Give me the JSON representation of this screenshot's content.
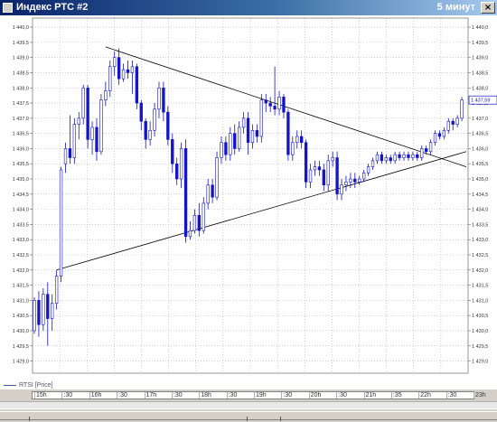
{
  "window": {
    "title": "Индекс РТС #2",
    "right_text": "5 минут",
    "close_glyph": "×"
  },
  "legend": "RTSI [Price]",
  "last_price": "1 437,59",
  "time_labels": [
    "15h",
    ":30",
    "16h",
    ":30",
    "17h",
    ":30",
    "18h",
    ":30",
    "19h",
    ":30",
    "20h",
    ":30",
    "21h",
    ":35",
    "22h",
    ":30",
    "23h"
  ],
  "chart_data": {
    "type": "candlestick",
    "title": "",
    "xlabel": "",
    "ylabel": "",
    "ylim": [
      1428.6,
      1440.3
    ],
    "y_ticks": [
      "1 440,0",
      "1 439,5",
      "1 439,0",
      "1 438,5",
      "1 438,0",
      "1 437,5",
      "1 437,0",
      "1 436,5",
      "1 436,0",
      "1 435,5",
      "1 435,0",
      "1 434,5",
      "1 434,0",
      "1 433,5",
      "1 433,0",
      "1 432,5",
      "1 432,0",
      "1 431,5",
      "1 431,0",
      "1 430,5",
      "1 430,0",
      "1 429,5",
      "1 429,0"
    ],
    "x_range": [
      0,
      97
    ],
    "candles": [
      {
        "x": 0,
        "o": 1430.0,
        "c": 1431.0,
        "h": 1431.1,
        "l": 1429.9
      },
      {
        "x": 1,
        "o": 1431.0,
        "c": 1430.2,
        "h": 1431.3,
        "l": 1429.8
      },
      {
        "x": 2,
        "o": 1430.2,
        "c": 1431.2,
        "h": 1431.4,
        "l": 1430.0
      },
      {
        "x": 3,
        "o": 1431.2,
        "c": 1430.4,
        "h": 1431.6,
        "l": 1429.5
      },
      {
        "x": 4,
        "o": 1430.4,
        "c": 1430.9,
        "h": 1431.2,
        "l": 1430.0
      },
      {
        "x": 5,
        "o": 1430.9,
        "c": 1431.8,
        "h": 1432.0,
        "l": 1430.7
      },
      {
        "x": 6,
        "o": 1431.8,
        "c": 1435.3,
        "h": 1435.4,
        "l": 1431.6
      },
      {
        "x": 7,
        "o": 1435.5,
        "c": 1436.0,
        "h": 1436.2,
        "l": 1435.2
      },
      {
        "x": 8,
        "o": 1436.0,
        "c": 1435.7,
        "h": 1437.1,
        "l": 1435.5
      },
      {
        "x": 9,
        "o": 1435.7,
        "c": 1436.8,
        "h": 1437.0,
        "l": 1435.5
      },
      {
        "x": 10,
        "o": 1436.8,
        "c": 1437.0,
        "h": 1437.2,
        "l": 1436.3
      },
      {
        "x": 11,
        "o": 1437.0,
        "c": 1438.0,
        "h": 1438.1,
        "l": 1436.8
      },
      {
        "x": 12,
        "o": 1438.0,
        "c": 1436.3,
        "h": 1438.1,
        "l": 1436.0
      },
      {
        "x": 13,
        "o": 1436.3,
        "c": 1436.7,
        "h": 1436.9,
        "l": 1435.8
      },
      {
        "x": 14,
        "o": 1436.7,
        "c": 1435.9,
        "h": 1437.0,
        "l": 1435.6
      },
      {
        "x": 15,
        "o": 1435.9,
        "c": 1437.6,
        "h": 1437.8,
        "l": 1435.8
      },
      {
        "x": 16,
        "o": 1437.6,
        "c": 1437.9,
        "h": 1438.2,
        "l": 1437.4
      },
      {
        "x": 17,
        "o": 1437.9,
        "c": 1438.7,
        "h": 1438.9,
        "l": 1437.7
      },
      {
        "x": 18,
        "o": 1438.7,
        "c": 1439.0,
        "h": 1439.2,
        "l": 1438.4
      },
      {
        "x": 19,
        "o": 1439.0,
        "c": 1438.3,
        "h": 1439.3,
        "l": 1438.1
      },
      {
        "x": 20,
        "o": 1438.3,
        "c": 1438.6,
        "h": 1438.8,
        "l": 1438.2
      },
      {
        "x": 21,
        "o": 1438.6,
        "c": 1438.5,
        "h": 1438.9,
        "l": 1438.3
      },
      {
        "x": 22,
        "o": 1438.5,
        "c": 1438.7,
        "h": 1438.9,
        "l": 1437.8
      },
      {
        "x": 23,
        "o": 1438.7,
        "c": 1437.5,
        "h": 1438.8,
        "l": 1437.3
      },
      {
        "x": 24,
        "o": 1437.5,
        "c": 1436.9,
        "h": 1437.6,
        "l": 1436.6
      },
      {
        "x": 25,
        "o": 1436.9,
        "c": 1436.3,
        "h": 1437.0,
        "l": 1436.0
      },
      {
        "x": 26,
        "o": 1436.3,
        "c": 1436.6,
        "h": 1436.9,
        "l": 1436.1
      },
      {
        "x": 27,
        "o": 1436.6,
        "c": 1437.3,
        "h": 1437.5,
        "l": 1436.4
      },
      {
        "x": 28,
        "o": 1437.3,
        "c": 1438.0,
        "h": 1438.2,
        "l": 1437.0
      },
      {
        "x": 29,
        "o": 1438.0,
        "c": 1437.2,
        "h": 1438.2,
        "l": 1436.9
      },
      {
        "x": 30,
        "o": 1437.2,
        "c": 1436.3,
        "h": 1437.4,
        "l": 1436.1
      },
      {
        "x": 31,
        "o": 1436.3,
        "c": 1435.5,
        "h": 1436.5,
        "l": 1435.2
      },
      {
        "x": 32,
        "o": 1435.5,
        "c": 1435.0,
        "h": 1435.7,
        "l": 1434.8
      },
      {
        "x": 33,
        "o": 1435.0,
        "c": 1436.0,
        "h": 1436.2,
        "l": 1434.7
      },
      {
        "x": 34,
        "o": 1436.0,
        "c": 1433.1,
        "h": 1436.3,
        "l": 1432.9
      },
      {
        "x": 35,
        "o": 1433.1,
        "c": 1433.3,
        "h": 1433.6,
        "l": 1433.0
      },
      {
        "x": 36,
        "o": 1433.3,
        "c": 1433.8,
        "h": 1434.0,
        "l": 1433.2
      },
      {
        "x": 37,
        "o": 1433.8,
        "c": 1433.3,
        "h": 1434.2,
        "l": 1433.1
      },
      {
        "x": 38,
        "o": 1433.3,
        "c": 1434.2,
        "h": 1434.4,
        "l": 1433.2
      },
      {
        "x": 39,
        "o": 1434.2,
        "c": 1434.8,
        "h": 1435.0,
        "l": 1434.0
      },
      {
        "x": 40,
        "o": 1434.8,
        "c": 1434.4,
        "h": 1435.0,
        "l": 1434.2
      },
      {
        "x": 41,
        "o": 1434.4,
        "c": 1435.7,
        "h": 1435.9,
        "l": 1434.3
      },
      {
        "x": 42,
        "o": 1435.7,
        "c": 1436.2,
        "h": 1436.4,
        "l": 1435.5
      },
      {
        "x": 43,
        "o": 1436.2,
        "c": 1435.8,
        "h": 1436.4,
        "l": 1435.6
      },
      {
        "x": 44,
        "o": 1435.8,
        "c": 1436.5,
        "h": 1436.7,
        "l": 1435.6
      },
      {
        "x": 45,
        "o": 1436.5,
        "c": 1436.0,
        "h": 1436.8,
        "l": 1435.8
      },
      {
        "x": 46,
        "o": 1436.0,
        "c": 1436.7,
        "h": 1436.9,
        "l": 1435.9
      },
      {
        "x": 47,
        "o": 1436.7,
        "c": 1437.0,
        "h": 1437.2,
        "l": 1436.5
      },
      {
        "x": 48,
        "o": 1437.0,
        "c": 1436.2,
        "h": 1437.2,
        "l": 1435.8
      },
      {
        "x": 49,
        "o": 1436.2,
        "c": 1436.6,
        "h": 1436.8,
        "l": 1436.0
      },
      {
        "x": 50,
        "o": 1436.6,
        "c": 1436.4,
        "h": 1436.8,
        "l": 1436.2
      },
      {
        "x": 51,
        "o": 1436.4,
        "c": 1437.6,
        "h": 1437.8,
        "l": 1436.2
      },
      {
        "x": 52,
        "o": 1437.6,
        "c": 1437.5,
        "h": 1437.8,
        "l": 1437.2
      },
      {
        "x": 53,
        "o": 1437.5,
        "c": 1437.4,
        "h": 1437.7,
        "l": 1437.2
      },
      {
        "x": 54,
        "o": 1437.4,
        "c": 1437.3,
        "h": 1438.7,
        "l": 1437.1
      },
      {
        "x": 55,
        "o": 1437.3,
        "c": 1437.7,
        "h": 1437.9,
        "l": 1437.1
      },
      {
        "x": 56,
        "o": 1437.7,
        "c": 1437.2,
        "h": 1437.8,
        "l": 1437.0
      },
      {
        "x": 57,
        "o": 1437.2,
        "c": 1435.8,
        "h": 1437.3,
        "l": 1435.6
      },
      {
        "x": 58,
        "o": 1435.8,
        "c": 1436.2,
        "h": 1436.4,
        "l": 1435.6
      },
      {
        "x": 59,
        "o": 1436.2,
        "c": 1436.4,
        "h": 1436.6,
        "l": 1436.0
      },
      {
        "x": 60,
        "o": 1436.4,
        "c": 1436.2,
        "h": 1436.6,
        "l": 1436.0
      },
      {
        "x": 61,
        "o": 1436.2,
        "c": 1434.9,
        "h": 1436.3,
        "l": 1434.7
      },
      {
        "x": 62,
        "o": 1434.9,
        "c": 1435.3,
        "h": 1435.5,
        "l": 1434.7
      },
      {
        "x": 63,
        "o": 1435.3,
        "c": 1435.4,
        "h": 1435.6,
        "l": 1435.1
      },
      {
        "x": 64,
        "o": 1435.4,
        "c": 1435.3,
        "h": 1435.6,
        "l": 1435.1
      },
      {
        "x": 65,
        "o": 1435.3,
        "c": 1434.8,
        "h": 1435.5,
        "l": 1434.6
      },
      {
        "x": 66,
        "o": 1434.8,
        "c": 1435.6,
        "h": 1435.8,
        "l": 1434.6
      },
      {
        "x": 67,
        "o": 1435.6,
        "c": 1435.7,
        "h": 1435.9,
        "l": 1435.4
      },
      {
        "x": 68,
        "o": 1435.7,
        "c": 1434.5,
        "h": 1435.9,
        "l": 1434.3
      },
      {
        "x": 69,
        "o": 1434.5,
        "c": 1434.8,
        "h": 1435.0,
        "l": 1434.3
      },
      {
        "x": 70,
        "o": 1434.8,
        "c": 1434.9,
        "h": 1435.1,
        "l": 1434.6
      },
      {
        "x": 71,
        "o": 1434.9,
        "c": 1435.0,
        "h": 1435.2,
        "l": 1434.7
      },
      {
        "x": 72,
        "o": 1435.0,
        "c": 1434.9,
        "h": 1435.2,
        "l": 1434.7
      },
      {
        "x": 73,
        "o": 1434.9,
        "c": 1435.0,
        "h": 1435.1,
        "l": 1434.8
      },
      {
        "x": 74,
        "o": 1435.0,
        "c": 1435.2,
        "h": 1435.3,
        "l": 1434.9
      },
      {
        "x": 75,
        "o": 1435.2,
        "c": 1435.4,
        "h": 1435.5,
        "l": 1435.1
      },
      {
        "x": 76,
        "o": 1435.4,
        "c": 1435.6,
        "h": 1435.7,
        "l": 1435.3
      },
      {
        "x": 77,
        "o": 1435.6,
        "c": 1435.8,
        "h": 1435.9,
        "l": 1435.5
      },
      {
        "x": 78,
        "o": 1435.8,
        "c": 1435.6,
        "h": 1435.9,
        "l": 1435.5
      },
      {
        "x": 79,
        "o": 1435.6,
        "c": 1435.7,
        "h": 1435.8,
        "l": 1435.5
      },
      {
        "x": 80,
        "o": 1435.7,
        "c": 1435.6,
        "h": 1435.8,
        "l": 1435.5
      },
      {
        "x": 81,
        "o": 1435.6,
        "c": 1435.8,
        "h": 1435.9,
        "l": 1435.5
      },
      {
        "x": 82,
        "o": 1435.8,
        "c": 1435.7,
        "h": 1435.9,
        "l": 1435.6
      },
      {
        "x": 83,
        "o": 1435.7,
        "c": 1435.8,
        "h": 1435.9,
        "l": 1435.6
      },
      {
        "x": 84,
        "o": 1435.8,
        "c": 1435.7,
        "h": 1435.9,
        "l": 1435.6
      },
      {
        "x": 85,
        "o": 1435.7,
        "c": 1435.8,
        "h": 1435.9,
        "l": 1435.6
      },
      {
        "x": 86,
        "o": 1435.8,
        "c": 1435.7,
        "h": 1435.9,
        "l": 1435.6
      },
      {
        "x": 87,
        "o": 1435.7,
        "c": 1436.0,
        "h": 1436.1,
        "l": 1435.6
      },
      {
        "x": 88,
        "o": 1436.0,
        "c": 1435.9,
        "h": 1436.1,
        "l": 1435.8
      },
      {
        "x": 89,
        "o": 1435.9,
        "c": 1436.2,
        "h": 1436.3,
        "l": 1435.8
      },
      {
        "x": 90,
        "o": 1436.2,
        "c": 1436.5,
        "h": 1436.6,
        "l": 1436.1
      },
      {
        "x": 91,
        "o": 1436.5,
        "c": 1436.4,
        "h": 1436.6,
        "l": 1436.3
      },
      {
        "x": 92,
        "o": 1436.4,
        "c": 1436.6,
        "h": 1436.7,
        "l": 1436.3
      },
      {
        "x": 93,
        "o": 1436.6,
        "c": 1436.9,
        "h": 1437.0,
        "l": 1436.5
      },
      {
        "x": 94,
        "o": 1436.9,
        "c": 1436.8,
        "h": 1437.0,
        "l": 1436.6
      },
      {
        "x": 95,
        "o": 1436.8,
        "c": 1437.0,
        "h": 1437.1,
        "l": 1436.7
      },
      {
        "x": 96,
        "o": 1437.0,
        "c": 1437.6,
        "h": 1437.7,
        "l": 1436.9
      }
    ],
    "trendlines": [
      {
        "name": "upper",
        "from": [
          16,
          1439.35
        ],
        "to": [
          97,
          1435.4
        ]
      },
      {
        "name": "lower",
        "from": [
          5,
          1432.0
        ],
        "to": [
          97,
          1435.9
        ]
      }
    ],
    "grid": true,
    "colors": {
      "bull": "#ffffff",
      "bear": "#1414c8",
      "outline": "#1414c8",
      "grid": "#b4b4b4",
      "trend": "#000000"
    }
  }
}
